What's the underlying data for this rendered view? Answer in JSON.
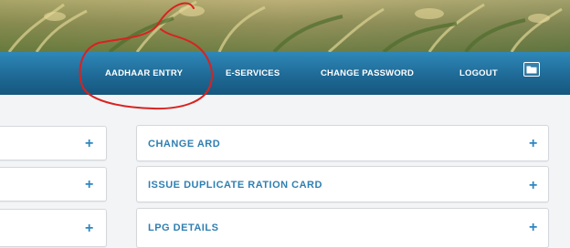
{
  "header": {
    "banner_name": "rice-field-banner"
  },
  "nav": {
    "items": [
      {
        "label": "AADHAAR ENTRY"
      },
      {
        "label": "E-SERVICES"
      },
      {
        "label": "CHANGE PASSWORD"
      },
      {
        "label": "LOGOUT"
      }
    ],
    "folder_icon": "folder-icon"
  },
  "panels": {
    "right": [
      {
        "label": "CHANGE ARD",
        "icon": "plus-icon"
      },
      {
        "label": "ISSUE DUPLICATE RATION CARD",
        "icon": "plus-icon"
      },
      {
        "label": "LPG DETAILS",
        "icon": "plus-icon"
      }
    ],
    "left_icon": "plus-icon"
  },
  "colors": {
    "nav_bg": "#1f6a96",
    "panel_text": "#2f7fb1",
    "plus": "#2f86c0",
    "annotation": "#d9221f"
  }
}
